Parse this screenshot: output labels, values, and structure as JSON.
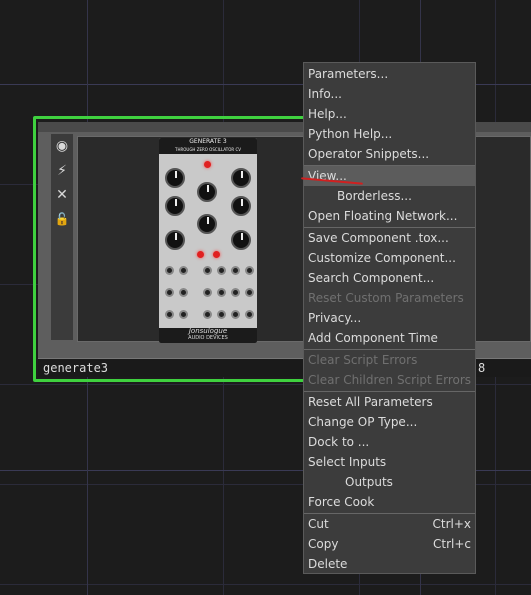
{
  "node": {
    "name": "generate3",
    "label_suffix": "8",
    "tools": [
      {
        "icon": "viewer-active-icon",
        "glyph": "◉"
      },
      {
        "icon": "cook-bolt-icon",
        "glyph": "⚡"
      },
      {
        "icon": "bypass-x-icon",
        "glyph": "✕"
      },
      {
        "icon": "lock-icon",
        "glyph": "🔓"
      }
    ],
    "module": {
      "title": "GENERATE 3",
      "subtitle": "THROUGH ZERO OSCILLATOR CV",
      "brand": "Jonsulogue",
      "brand_sub": "AUDIO DEVICES"
    }
  },
  "menu": {
    "items": [
      {
        "label": "Parameters..."
      },
      {
        "label": "Info..."
      },
      {
        "label": "Help..."
      },
      {
        "label": "Python Help..."
      },
      {
        "label": "Operator Snippets..."
      },
      {
        "label": "View...",
        "highlighted": true
      },
      {
        "label": "Borderless..."
      },
      {
        "label": "Open Floating Network..."
      },
      {
        "label": "Save Component .tox..."
      },
      {
        "label": "Customize Component..."
      },
      {
        "label": "Search Component..."
      },
      {
        "label": "Reset Custom Parameters",
        "disabled": true
      },
      {
        "label": "Privacy..."
      },
      {
        "label": "Add Component Time"
      },
      {
        "label": "Clear Script Errors",
        "disabled": true
      },
      {
        "label": "Clear Children Script Errors",
        "disabled": true
      },
      {
        "label": "Reset All Parameters"
      },
      {
        "label": "Change OP Type..."
      },
      {
        "label": "Dock to ..."
      },
      {
        "label": "Select Inputs"
      },
      {
        "label": "Outputs"
      },
      {
        "label": "Force Cook"
      },
      {
        "label": "Cut",
        "shortcut": "Ctrl+x"
      },
      {
        "label": "Copy",
        "shortcut": "Ctrl+c"
      },
      {
        "label": "Delete"
      }
    ]
  },
  "colors": {
    "selection_outline": "#3fd13f",
    "annotation_stroke": "#d02020",
    "menu_background": "#3c3c3c"
  }
}
